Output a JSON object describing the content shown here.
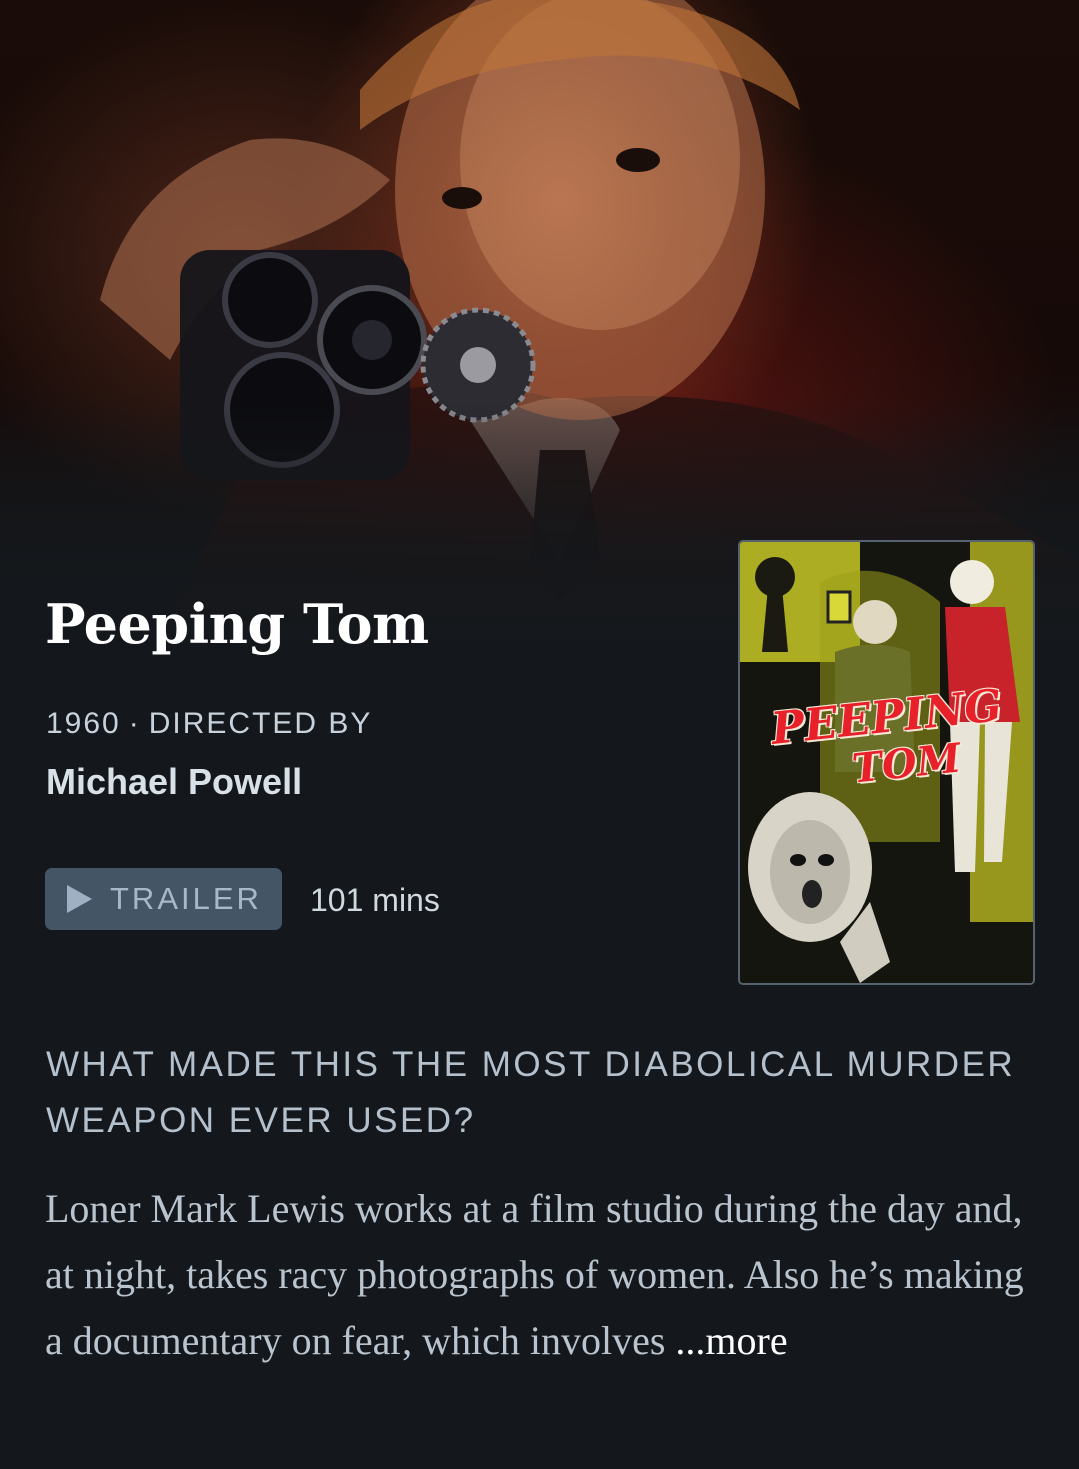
{
  "film": {
    "title": "Peeping Tom",
    "year": "1960",
    "separator": "·",
    "directed_by_label": "DIRECTED BY",
    "director": "Michael Powell",
    "runtime": "101 mins",
    "tagline": "WHAT MADE THIS THE MOST DIABOLICAL MURDER WEAPON EVER USED?",
    "synopsis": "Loner Mark Lewis works at a film studio during the day and, at night, takes racy photographs of women. Also he’s making a documentary on fear, which involves",
    "more_label": "...more"
  },
  "trailer": {
    "label": "TRAILER",
    "icon": "play-icon"
  },
  "poster": {
    "title_line1": "PEEPING",
    "title_line2": "TOM"
  },
  "colors": {
    "background": "#14181c",
    "trailer_button": "#445566",
    "poster_title": "#e8202a",
    "poster_accent": "#d6d62a"
  }
}
